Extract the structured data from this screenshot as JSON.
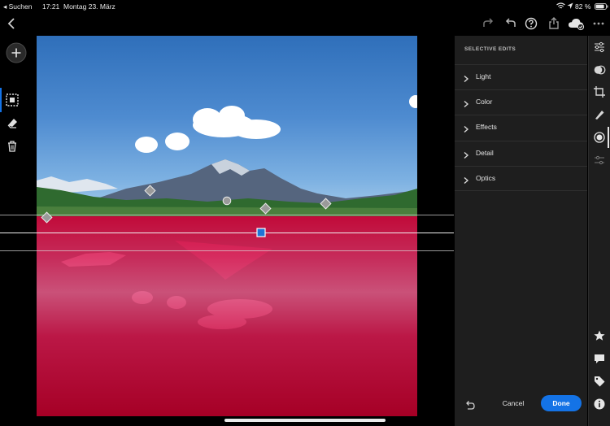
{
  "status_bar": {
    "back_app": "◂ Suchen",
    "time": "17:21",
    "date": "Montag 23. März",
    "battery": "82 %"
  },
  "top_bar": {
    "icons": [
      "back-chevron-icon",
      "redo-icon",
      "undo-icon",
      "help-icon",
      "share-icon",
      "cloud-sync-icon",
      "more-icon"
    ]
  },
  "left_tools": {
    "icons": [
      "add-icon",
      "selection-brush-icon",
      "eraser-icon",
      "trash-icon"
    ]
  },
  "panel": {
    "title": "SELECTIVE EDITS",
    "sections": [
      {
        "label": "Light"
      },
      {
        "label": "Color"
      },
      {
        "label": "Effects"
      },
      {
        "label": "Detail"
      },
      {
        "label": "Optics"
      }
    ],
    "cancel_label": "Cancel",
    "done_label": "Done"
  },
  "right_rail": {
    "icons": [
      "edit-sliders-icon",
      "presets-icon",
      "crop-icon",
      "healing-icon",
      "selective-icon",
      "versions-icon",
      "rating-star-icon",
      "comment-icon",
      "tag-icon",
      "info-icon"
    ]
  },
  "colors": {
    "accent": "#1473e6",
    "mask_overlay": "#d60c40",
    "panel_bg": "#1e1e1e",
    "sky": "#4e8bd0"
  }
}
